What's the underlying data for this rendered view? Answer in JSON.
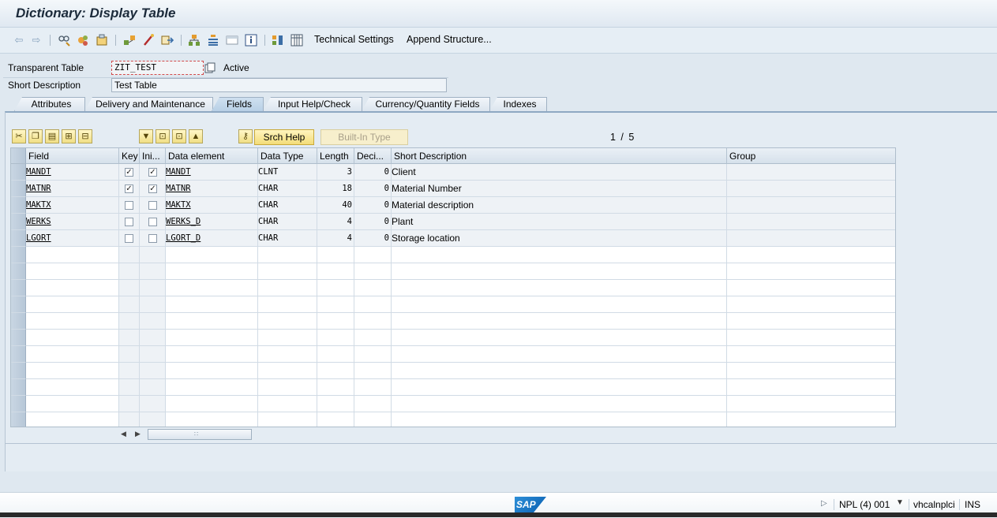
{
  "window": {
    "title": "Dictionary: Display Table"
  },
  "toolbar": {
    "icons": [
      "back-icon",
      "forward-icon",
      "other-object-icon",
      "display-change-icon",
      "activate-icon",
      "where-used-icon",
      "object-list-icon",
      "display-object-list-icon",
      "hierarchy-icon",
      "navigation-window-icon",
      "info-icon",
      "layout-icon",
      "grid-icon"
    ],
    "technical_settings": "Technical Settings",
    "append_structure": "Append Structure..."
  },
  "header": {
    "table_label": "Transparent Table",
    "table_name": "ZIT_TEST",
    "status": "Active",
    "short_desc_label": "Short Description",
    "short_desc_value": "Test Table"
  },
  "tabs": [
    {
      "label": "Attributes",
      "active": false
    },
    {
      "label": "Delivery and Maintenance",
      "active": false
    },
    {
      "label": "Fields",
      "active": true
    },
    {
      "label": "Input Help/Check",
      "active": false
    },
    {
      "label": "Currency/Quantity Fields",
      "active": false
    },
    {
      "label": "Indexes",
      "active": false
    }
  ],
  "fields_toolbar": {
    "srch_help": "Srch Help",
    "builtin_type": "Built-In Type",
    "page_indicator": "1 / 5"
  },
  "grid": {
    "columns": [
      "Field",
      "Key",
      "Ini...",
      "Data element",
      "Data Type",
      "Length",
      "Deci...",
      "Short Description",
      "Group"
    ],
    "rows": [
      {
        "field": "MANDT",
        "key": true,
        "initial": true,
        "data_element": "MANDT",
        "data_type": "CLNT",
        "length": "3",
        "decimals": "0",
        "short_desc": "Client",
        "group": ""
      },
      {
        "field": "MATNR",
        "key": true,
        "initial": true,
        "data_element": "MATNR",
        "data_type": "CHAR",
        "length": "18",
        "decimals": "0",
        "short_desc": "Material Number",
        "group": ""
      },
      {
        "field": "MAKTX",
        "key": false,
        "initial": false,
        "data_element": "MAKTX",
        "data_type": "CHAR",
        "length": "40",
        "decimals": "0",
        "short_desc": "Material description",
        "group": ""
      },
      {
        "field": "WERKS",
        "key": false,
        "initial": false,
        "data_element": "WERKS_D",
        "data_type": "CHAR",
        "length": "4",
        "decimals": "0",
        "short_desc": "Plant",
        "group": ""
      },
      {
        "field": "LGORT",
        "key": false,
        "initial": false,
        "data_element": "LGORT_D",
        "data_type": "CHAR",
        "length": "4",
        "decimals": "0",
        "short_desc": "Storage location",
        "group": ""
      }
    ],
    "empty_rows": 11
  },
  "statusbar": {
    "logo": "SAP",
    "system": "NPL (4) 001",
    "server": "vhcalnplci",
    "mode": "INS"
  },
  "colors": {
    "accent_yellow": "#f3dc78",
    "tab_active": "#b8d0e6",
    "background": "#dfe8f0"
  }
}
